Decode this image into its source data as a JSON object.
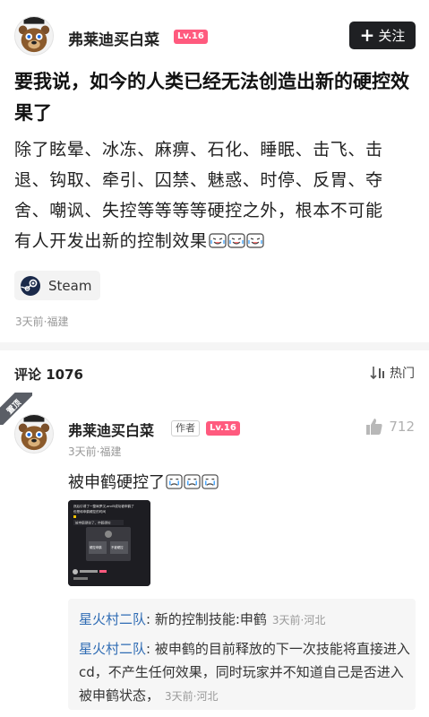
{
  "post": {
    "author": {
      "name": "弗莱迪买白菜",
      "level": "Lv.16",
      "avatar_icon": "freddy-bear-avatar-icon"
    },
    "follow_label": "关注",
    "follow_icon": "plus-icon",
    "title": "要我说，如今的人类已经无法创造出新的硬控效果了",
    "body_lines": [
      "除了眩晕、冰冻、麻痹、石化、睡眠、击飞、击",
      "退、钩取、牵引、囚禁、魅惑、时停、反胃、夺",
      "舍、嘲讽、失控等等等等硬控之外，根本不可能",
      "有人开发出新的控制效果"
    ],
    "body_emoji": "laughing-crying-emoji",
    "tag": {
      "label": "Steam",
      "icon": "steam-icon"
    },
    "meta": "3天前·福建"
  },
  "comments_header": {
    "count_label": "评论 1076",
    "sort_label": "热门",
    "sort_icon": "sort-icon"
  },
  "pinned_comment": {
    "pinned_label": "置顶",
    "author_name": "弗莱迪买白菜",
    "author_badge": "作者",
    "level": "Lv.16",
    "likes": "712",
    "like_icon": "thumbs-up-icon",
    "meta": "3天前·福建",
    "text": "被申鹤硬控了",
    "text_emoji": "crying-emoji",
    "image": {
      "text_top_1": "然后引诱了一整局罗汉,and5成功被申鹤了",
      "text_top_2": "但是和申鹤硬控的时间",
      "text_mid": "被申鹤硬控了，申鹤硬控",
      "button_left": "硬控申鹤",
      "button_right": "不被硬控"
    },
    "replies": [
      {
        "user": "星火村二队",
        "text": "新的控制技能:申鹤",
        "meta": "3天前·河北"
      },
      {
        "user": "星火村二队",
        "text": "被申鹤的目前释放的下一次技能将直接进入cd，不产生任何效果，同时玩家并不知道自己是否进入被申鹤状态，",
        "meta": "3天前·河北"
      }
    ]
  },
  "colors": {
    "level_badge": "#ff5a7e",
    "follow_button": "#1f2023",
    "reply_user": "#2f6cb4",
    "pinned_ribbon": "#5a5e66"
  }
}
